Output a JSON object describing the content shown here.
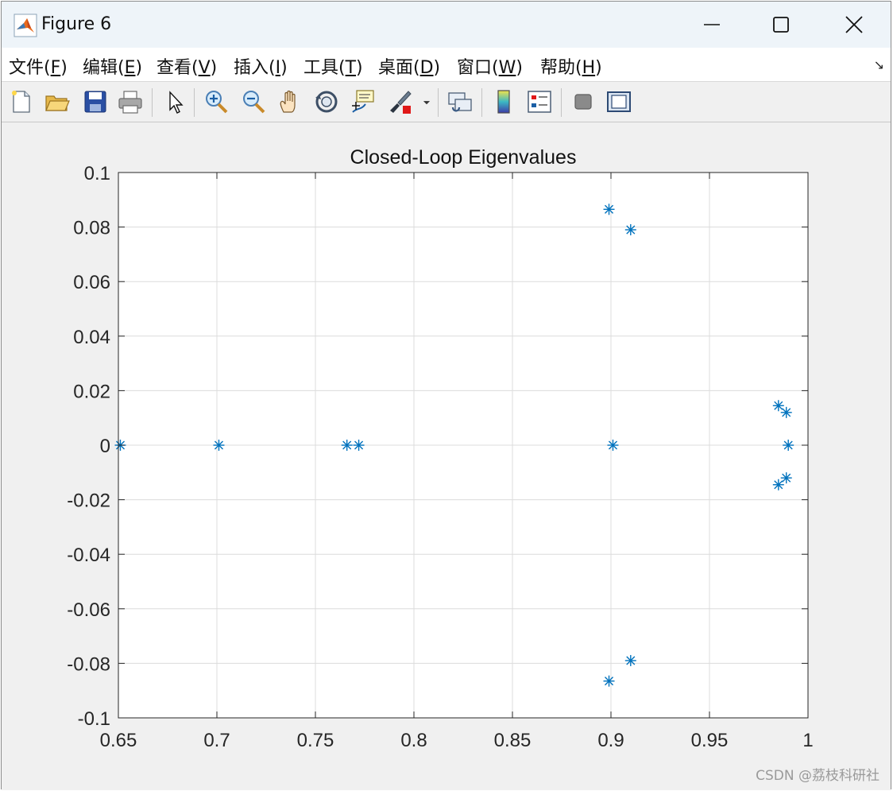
{
  "window": {
    "title": "Figure 6"
  },
  "menu": [
    {
      "label": "文件(",
      "key": "F",
      "suffix": ")"
    },
    {
      "label": "编辑(",
      "key": "E",
      "suffix": ")"
    },
    {
      "label": "查看(",
      "key": "V",
      "suffix": ")"
    },
    {
      "label": "插入(",
      "key": "I",
      "suffix": ")"
    },
    {
      "label": "工具(",
      "key": "T",
      "suffix": ")"
    },
    {
      "label": "桌面(",
      "key": "D",
      "suffix": ")"
    },
    {
      "label": "窗口(",
      "key": "W",
      "suffix": ")"
    },
    {
      "label": "帮助(",
      "key": "H",
      "suffix": ")"
    }
  ],
  "toolbar_icons": [
    "new-figure-icon",
    "open-file-icon",
    "save-figure-icon",
    "print-figure-icon",
    "edit-plot-icon",
    "zoom-in-icon",
    "zoom-out-icon",
    "pan-icon",
    "rotate-3d-icon",
    "data-cursor-icon",
    "brush-icon",
    "link-plot-icon",
    "insert-colorbar-icon",
    "insert-legend-icon",
    "hide-plot-tools-icon",
    "show-plot-tools-icon"
  ],
  "colors": {
    "marker": "#0072bd",
    "grid": "#dcdcdc",
    "axes": "#262626"
  },
  "chart_data": {
    "type": "scatter",
    "title": "Closed-Loop Eigenvalues",
    "xlabel": "",
    "ylabel": "",
    "xlim": [
      0.65,
      1
    ],
    "ylim": [
      -0.1,
      0.1
    ],
    "xticks": [
      "0.65",
      "0.7",
      "0.75",
      "0.8",
      "0.85",
      "0.9",
      "0.95",
      "1"
    ],
    "yticks": [
      "-0.1",
      "-0.08",
      "-0.06",
      "-0.04",
      "-0.02",
      "0",
      "0.02",
      "0.04",
      "0.06",
      "0.08",
      "0.1"
    ],
    "grid": true,
    "marker": "asterisk",
    "points": [
      {
        "x": 0.651,
        "y": 0
      },
      {
        "x": 0.701,
        "y": 0
      },
      {
        "x": 0.766,
        "y": 0
      },
      {
        "x": 0.772,
        "y": 0
      },
      {
        "x": 0.899,
        "y": 0.0865
      },
      {
        "x": 0.91,
        "y": 0.079
      },
      {
        "x": 0.899,
        "y": -0.0865
      },
      {
        "x": 0.91,
        "y": -0.079
      },
      {
        "x": 0.901,
        "y": 0
      },
      {
        "x": 0.985,
        "y": 0.0145
      },
      {
        "x": 0.989,
        "y": 0.012
      },
      {
        "x": 0.99,
        "y": 0
      },
      {
        "x": 0.985,
        "y": -0.0145
      },
      {
        "x": 0.989,
        "y": -0.012
      }
    ]
  },
  "watermark": "CSDN @荔枝科研社"
}
